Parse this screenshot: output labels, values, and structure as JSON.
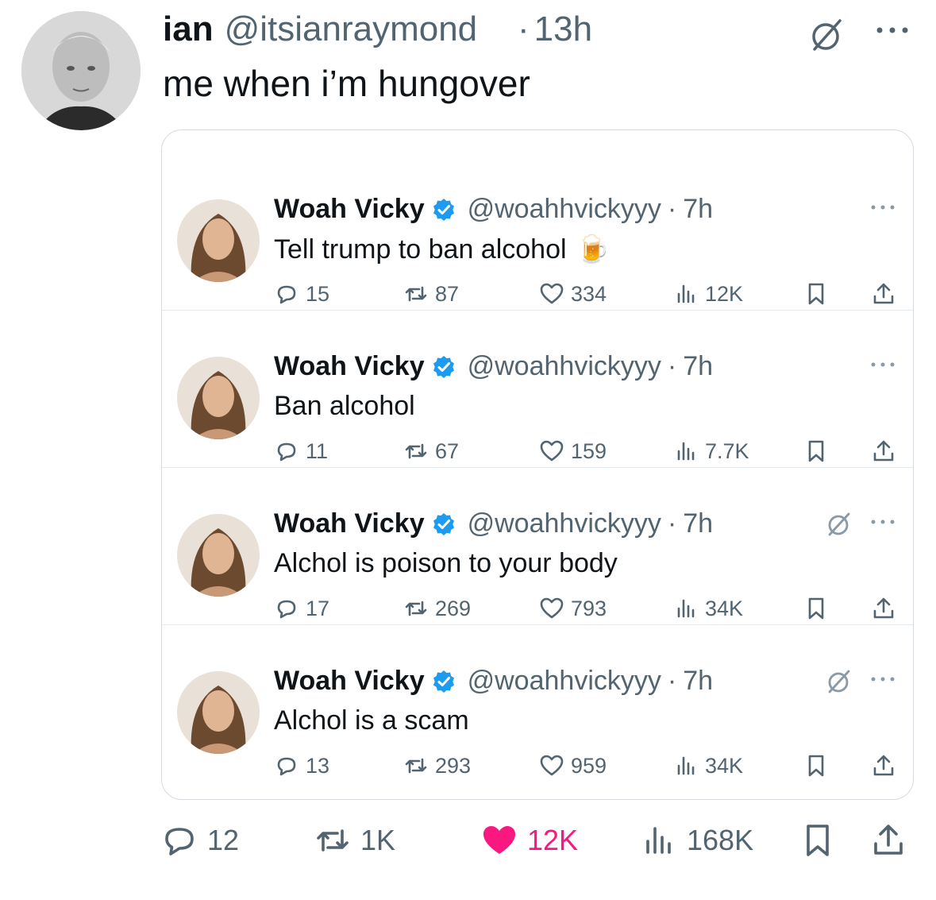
{
  "author": {
    "name": "ian",
    "handle": "@itsianraymond",
    "time": "13h",
    "text": "me when i’m hungover"
  },
  "quoted_tweets": [
    {
      "name": "Woah Vicky",
      "handle": "@woahhvickyyy",
      "time": "7h",
      "text": "Tell trump to ban alcohol",
      "emoji": "🍺",
      "replies": "15",
      "retweets": "87",
      "likes": "334",
      "views": "12K",
      "muted": false
    },
    {
      "name": "Woah Vicky",
      "handle": "@woahhvickyyy",
      "time": "7h",
      "text": "Ban alcohol",
      "replies": "11",
      "retweets": "67",
      "likes": "159",
      "views": "7.7K",
      "muted": false
    },
    {
      "name": "Woah Vicky",
      "handle": "@woahhvickyyy",
      "time": "7h",
      "text": "Alchol is poison to your body",
      "replies": "17",
      "retweets": "269",
      "likes": "793",
      "views": "34K",
      "muted": true
    },
    {
      "name": "Woah Vicky",
      "handle": "@woahhvickyyy",
      "time": "7h",
      "text": "Alchol is a scam",
      "replies": "13",
      "retweets": "293",
      "likes": "959",
      "views": "34K",
      "muted": true
    }
  ],
  "stats": {
    "replies": "12",
    "retweets": "1K",
    "likes": "12K",
    "views": "168K"
  },
  "colors": {
    "verified": "#1d9bf0",
    "like_active": "#f91880",
    "secondary_text": "#536471"
  }
}
